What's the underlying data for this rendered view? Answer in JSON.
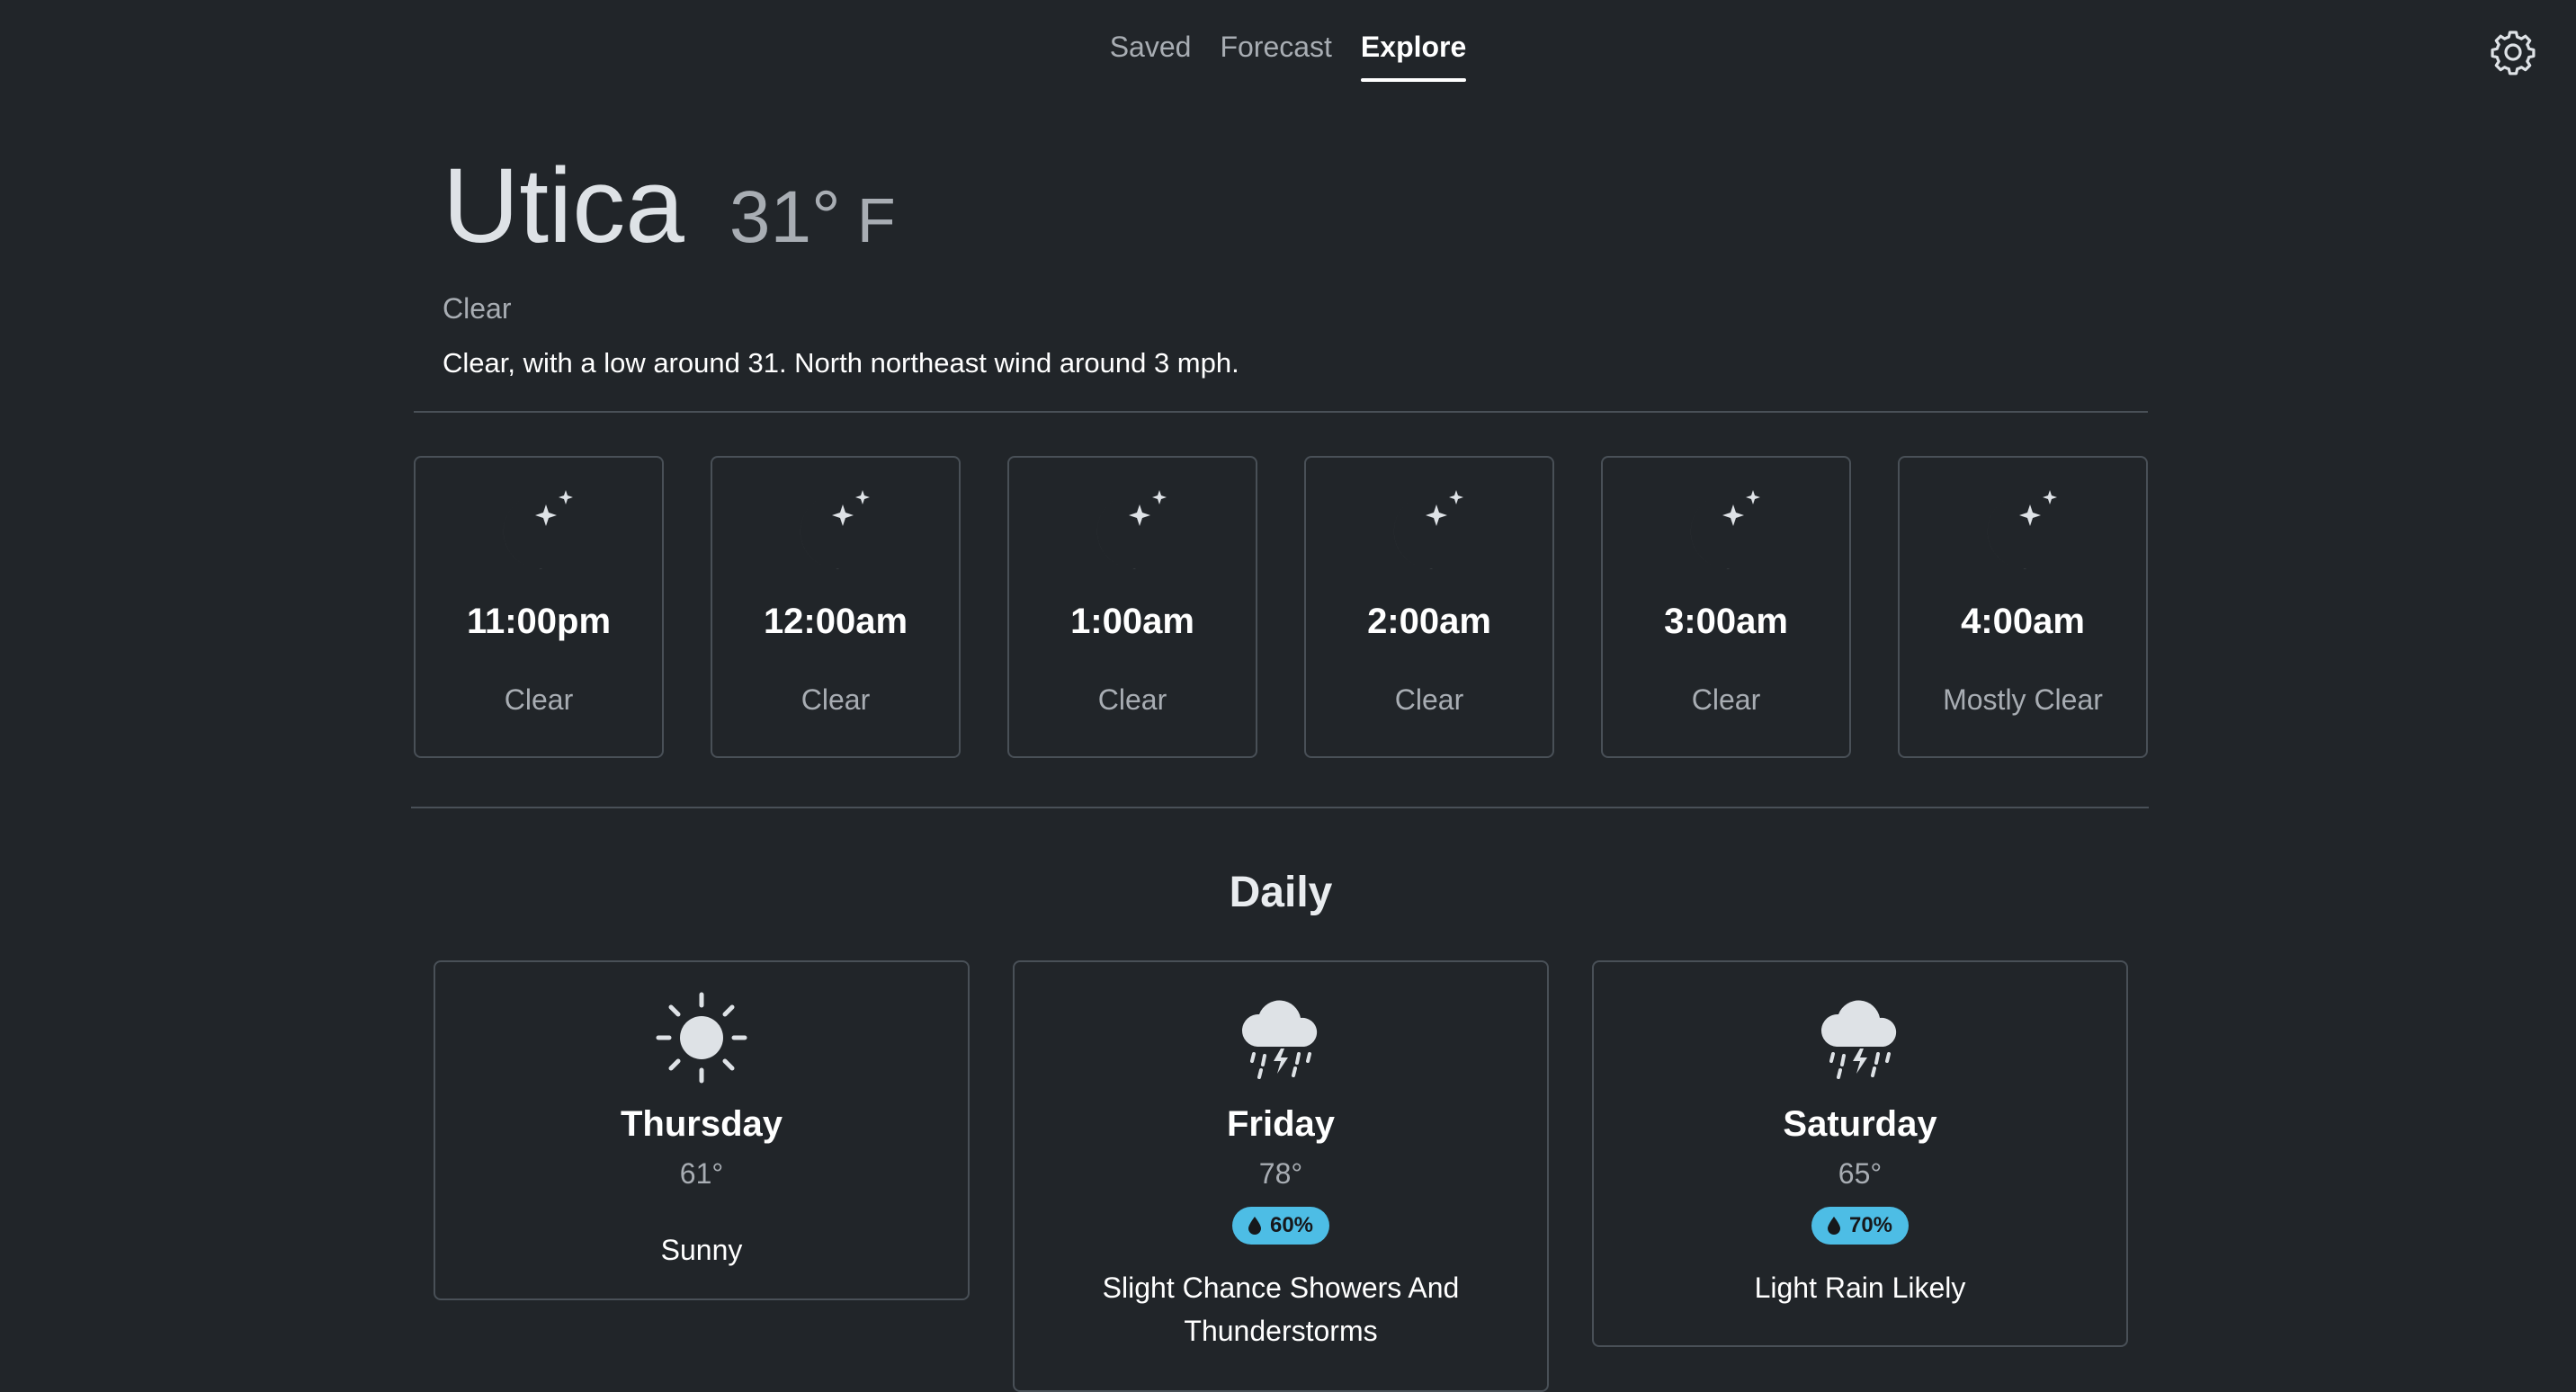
{
  "nav": {
    "tabs": [
      {
        "label": "Saved",
        "active": false
      },
      {
        "label": "Forecast",
        "active": false
      },
      {
        "label": "Explore",
        "active": true
      }
    ],
    "settings_icon": "gear-icon"
  },
  "current": {
    "city": "Utica",
    "temp": "31°",
    "unit": "F",
    "condition": "Clear",
    "description": "Clear, with a low around 31. North northeast wind around 3 mph."
  },
  "hourly": [
    {
      "time": "11:00pm",
      "condition": "Clear",
      "icon": "moon-stars-icon"
    },
    {
      "time": "12:00am",
      "condition": "Clear",
      "icon": "moon-stars-icon"
    },
    {
      "time": "1:00am",
      "condition": "Clear",
      "icon": "moon-stars-icon"
    },
    {
      "time": "2:00am",
      "condition": "Clear",
      "icon": "moon-stars-icon"
    },
    {
      "time": "3:00am",
      "condition": "Clear",
      "icon": "moon-stars-icon"
    },
    {
      "time": "4:00am",
      "condition": "Mostly Clear",
      "icon": "moon-stars-icon"
    }
  ],
  "daily": {
    "title": "Daily",
    "days": [
      {
        "name": "Thursday",
        "temp": "61°",
        "condition": "Sunny",
        "icon": "sun-icon"
      },
      {
        "name": "Friday",
        "temp": "78°",
        "precip": "60%",
        "condition": "Slight Chance Showers And Thunderstorms",
        "icon": "thunderstorm-cloud-icon"
      },
      {
        "name": "Saturday",
        "temp": "65°",
        "precip": "70%",
        "condition": "Light Rain Likely",
        "icon": "thunderstorm-cloud-icon"
      }
    ]
  },
  "colors": {
    "background": "#212529",
    "text": "#dee2e6",
    "muted": "#a8adb3",
    "border": "#495057",
    "badge": "#4dbde5"
  }
}
